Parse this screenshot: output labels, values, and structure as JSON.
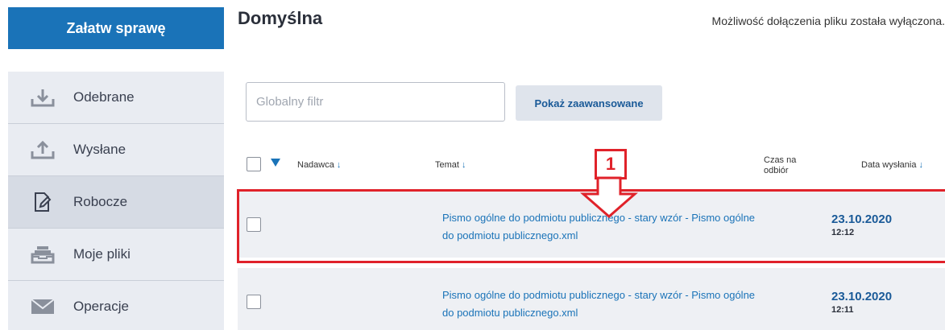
{
  "cta_label": "Załatw sprawę",
  "sidebar": {
    "items": [
      {
        "label": "Odebrane",
        "icon": "inbox-download-icon"
      },
      {
        "label": "Wysłane",
        "icon": "outbox-upload-icon"
      },
      {
        "label": "Robocze",
        "icon": "draft-edit-icon",
        "active": true
      },
      {
        "label": "Moje pliki",
        "icon": "file-tray-icon"
      },
      {
        "label": "Operacje",
        "icon": "envelope-icon"
      }
    ]
  },
  "header": {
    "title": "Domyślna",
    "notice": "Możliwość dołączenia pliku została wyłączona."
  },
  "filter": {
    "placeholder": "Globalny filtr",
    "value": "",
    "advanced_button": "Pokaż zaawansowane"
  },
  "table": {
    "columns": {
      "nadawca": "Nadawca",
      "temat": "Temat",
      "czas": "Czas na odbiór",
      "data": "Data wysłania"
    },
    "sort_arrow": "↓",
    "rows": [
      {
        "subject": "Pismo ogólne do podmiotu publicznego - stary wzór - Pismo ogólne do podmiotu publicznego.xml",
        "date": "23.10.2020",
        "time": "12:12"
      },
      {
        "subject": "Pismo ogólne do podmiotu publicznego - stary wzór - Pismo ogólne do podmiotu publicznego.xml",
        "date": "23.10.2020",
        "time": "12:11"
      }
    ]
  },
  "annotation": {
    "number": "1",
    "color": "#e0222a"
  },
  "colors": {
    "primary": "#1a73b8",
    "sidebar_bg": "#e9ecf2",
    "row_bg": "#eef0f4"
  }
}
